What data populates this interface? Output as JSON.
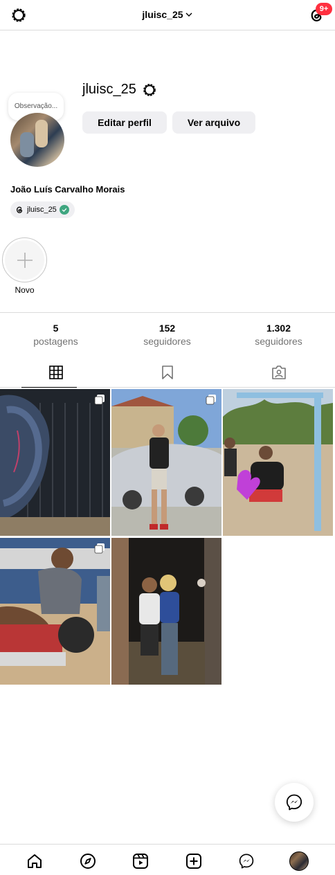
{
  "topbar": {
    "username": "jluisc_25",
    "notification_badge": "9+"
  },
  "profile": {
    "note_placeholder": "Observação...",
    "username": "jluisc_25",
    "edit_profile_label": "Editar perfil",
    "view_archive_label": "Ver arquivo",
    "full_name": "João Luís Carvalho Morais",
    "threads_handle": "jluisc_25"
  },
  "highlights": {
    "new_label": "Novo"
  },
  "stats": {
    "posts_count": "5",
    "posts_label": "postagens",
    "followers_count": "152",
    "followers_label": "seguidores",
    "following_count": "1.302",
    "following_label": "seguidores"
  },
  "tabs": [
    "grid-icon",
    "saved-icon",
    "tagged-icon"
  ],
  "posts": [
    {
      "icon": "carousel-icon"
    },
    {
      "icon": "carousel-icon"
    },
    {
      "icon": null
    },
    {
      "icon": "carousel-icon"
    },
    {
      "icon": null
    }
  ],
  "bottom_nav": [
    "home-icon",
    "explore-icon",
    "reels-icon",
    "new-post-icon",
    "messenger-icon",
    "profile-avatar"
  ],
  "colors": {
    "badge": "#ff3040",
    "verified": "#3fa680",
    "button_bg": "#efeff2",
    "secondary_text": "#737373"
  }
}
